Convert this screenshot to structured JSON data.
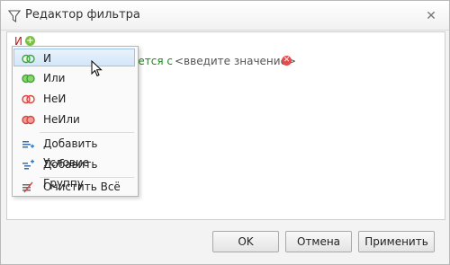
{
  "window": {
    "title": "Редактор фильтра",
    "close_glyph": "✕"
  },
  "filter": {
    "root_group_op": "И",
    "add_glyph": "+",
    "condition_op_partial": "ается с",
    "condition_value_placeholder": "<введите значение>",
    "remove_glyph": "✕"
  },
  "menu": {
    "items": [
      {
        "label": "И",
        "icon": "and-rings-icon",
        "color": "#3aa83a"
      },
      {
        "label": "Или",
        "icon": "or-rings-icon",
        "color": "#3aa83a"
      },
      {
        "label": "НеИ",
        "icon": "not-and-rings-icon",
        "color": "#d9453f"
      },
      {
        "label": "НеИли",
        "icon": "not-or-rings-icon",
        "color": "#d9453f"
      },
      {
        "label": "Добавить Условие",
        "icon": "add-condition-icon"
      },
      {
        "label": "Добавить Группу",
        "icon": "add-group-icon"
      },
      {
        "label": "Очистить Всё",
        "icon": "clear-all-icon"
      }
    ],
    "selected_index": 0
  },
  "buttons": {
    "ok": "OK",
    "cancel": "Отмена",
    "apply": "Применить"
  },
  "colors": {
    "group_op": "#d11414",
    "condition_op": "#1d8a1d",
    "selection_bg": "#d3e6f8",
    "selection_border": "#9cc4e8"
  }
}
